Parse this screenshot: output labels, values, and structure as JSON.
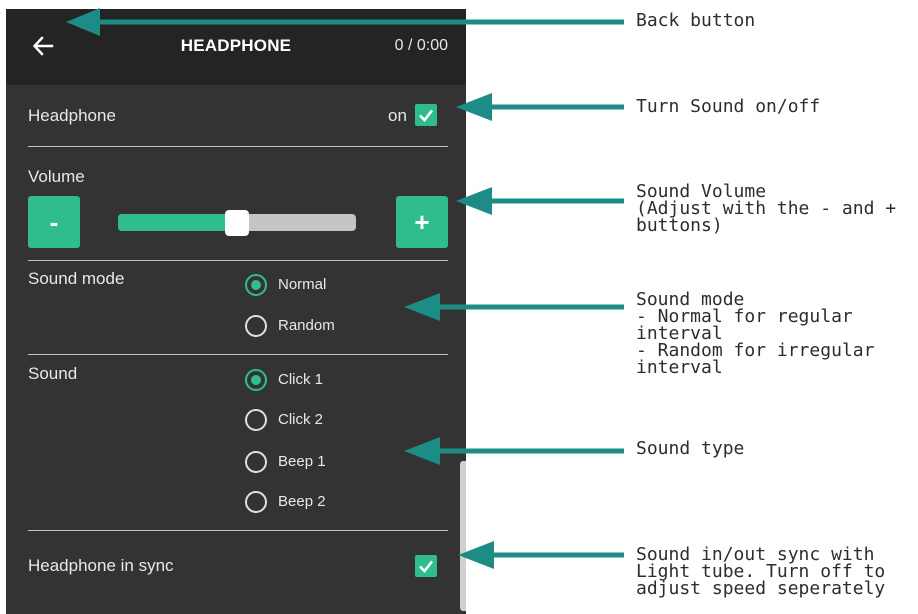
{
  "header": {
    "title": "HEADPHONE",
    "counter": "0 / 0:00"
  },
  "headphone": {
    "label": "Headphone",
    "state_label": "on",
    "checked": true
  },
  "volume": {
    "label": "Volume",
    "minus_label": "-",
    "plus_label": "+",
    "level_fraction": 0.5
  },
  "sound_mode": {
    "label": "Sound mode",
    "options": [
      {
        "label": "Normal",
        "selected": true
      },
      {
        "label": "Random",
        "selected": false
      }
    ]
  },
  "sound": {
    "label": "Sound",
    "options": [
      {
        "label": "Click 1",
        "selected": true
      },
      {
        "label": "Click 2",
        "selected": false
      },
      {
        "label": "Beep 1",
        "selected": false
      },
      {
        "label": "Beep 2",
        "selected": false
      }
    ]
  },
  "sync": {
    "label": "Headphone in sync",
    "checked": true
  },
  "annotations": {
    "back": [
      "Back button"
    ],
    "sound_toggle": [
      "Turn Sound on/off"
    ],
    "volume": [
      "Sound Volume",
      "(Adjust with the - and +",
      "buttons)"
    ],
    "mode": [
      "Sound mode",
      "- Normal for regular",
      "interval",
      "- Random for irregular",
      "interval"
    ],
    "type": [
      "Sound type"
    ],
    "sync": [
      "Sound in/out sync with",
      "Light tube. Turn off to",
      "adjust speed seperately"
    ]
  },
  "colors": {
    "accent": "#2fbd90",
    "arrow": "#1d8c86",
    "panel": "#333333",
    "header": "#242424"
  },
  "icons": {
    "back": "arrow-left-icon",
    "check": "checkmark-icon",
    "slider": "slider-thumb"
  }
}
